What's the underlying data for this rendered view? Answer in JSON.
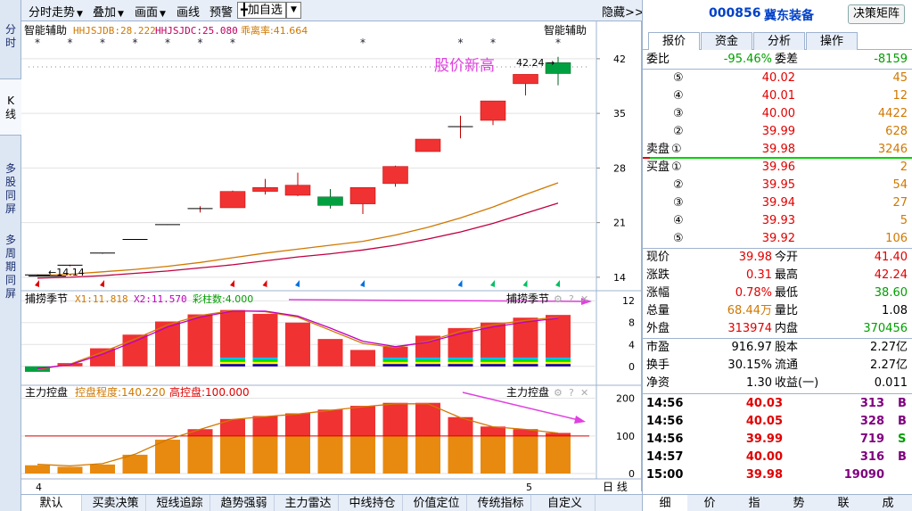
{
  "left_tabs": [
    {
      "label": "分\n时",
      "active": false
    },
    {
      "label": "K\n线",
      "active": true
    },
    {
      "label": "多\n股\n同\n屏",
      "active": false
    },
    {
      "label": "多\n周\n期\n同\n屏",
      "active": false
    }
  ],
  "toolbar": {
    "items": [
      "分时走势",
      "叠加",
      "画面",
      "画线",
      "预警"
    ],
    "add_select": "╋加自选",
    "hide": "隐藏>>"
  },
  "main_panel": {
    "indicator_name": "智能辅助",
    "indicator_name_right": "智能辅助",
    "legend": [
      {
        "text": "HHJSJDB:28.222",
        "color": "#d07800"
      },
      {
        "text": "HHJSJDC:25.080",
        "color": "#c00060"
      },
      {
        "text": "乖离率:41.664",
        "color": "#d07800"
      }
    ],
    "annotation": "股价新高",
    "annotation_color": "#e040e0",
    "high_label": "42.24",
    "low_label": "14.14",
    "y_ticks": [
      "42",
      "35",
      "28",
      "21",
      "14"
    ]
  },
  "sub_panel_1": {
    "name": "捕捞季节",
    "name_right": "捕捞季节",
    "legend": [
      {
        "text": "X1:11.818",
        "color": "#d07800"
      },
      {
        "text": "X2:11.570",
        "color": "#c000c0"
      },
      {
        "text": "彩柱数:4.000",
        "color": "#00a000"
      }
    ],
    "y_ticks": [
      "12",
      "8",
      "4",
      "0"
    ]
  },
  "sub_panel_2": {
    "name": "主力控盘",
    "name_right": "主力控盘",
    "legend": [
      {
        "text": "控盘程度:140.220",
        "color": "#d07800"
      },
      {
        "text": "高控盘:100.000",
        "color": "#e00000"
      }
    ],
    "y_ticks": [
      "200",
      "100",
      "0"
    ]
  },
  "x_axis": {
    "labels": [
      "4",
      "5"
    ],
    "period": "日 线"
  },
  "bottom_tabs": [
    "默认",
    "买卖决策",
    "短线追踪",
    "趋势强弱",
    "主力雷达",
    "中线持仓",
    "价值定位",
    "传统指标",
    "自定义"
  ],
  "chart_data": [
    {
      "type": "candlestick",
      "title": "智能辅助",
      "candles": [
        {
          "open": 14.14,
          "close": 14.3,
          "high": 14.35,
          "low": 14.14
        },
        {
          "open": 15.4,
          "close": 15.55,
          "high": 15.6,
          "low": 15.4
        },
        {
          "open": 17.0,
          "close": 17.1,
          "high": 17.1,
          "low": 17.0
        },
        {
          "open": 18.8,
          "close": 18.85,
          "high": 18.85,
          "low": 18.8
        },
        {
          "open": 20.7,
          "close": 20.75,
          "high": 20.75,
          "low": 20.7
        },
        {
          "open": 22.8,
          "close": 22.8,
          "high": 23.1,
          "low": 22.3
        },
        {
          "open": 22.9,
          "close": 25.0,
          "high": 25.1,
          "low": 22.9
        },
        {
          "open": 25.0,
          "close": 25.5,
          "high": 26.6,
          "low": 24.6
        },
        {
          "open": 24.5,
          "close": 25.8,
          "high": 27.4,
          "low": 24.4
        },
        {
          "open": 24.3,
          "close": 23.2,
          "high": 25.3,
          "low": 22.8
        },
        {
          "open": 23.4,
          "close": 25.5,
          "high": 25.5,
          "low": 22.1
        },
        {
          "open": 26.0,
          "close": 28.2,
          "high": 28.3,
          "low": 25.6
        },
        {
          "open": 30.1,
          "close": 31.7,
          "high": 31.7,
          "low": 30.1
        },
        {
          "open": 33.2,
          "close": 33.3,
          "high": 34.7,
          "low": 31.8
        },
        {
          "open": 34.1,
          "close": 36.6,
          "high": 36.6,
          "low": 33.5
        },
        {
          "open": 38.8,
          "close": 40.0,
          "high": 40.0,
          "low": 37.3
        },
        {
          "open": 41.5,
          "close": 40.1,
          "high": 42.24,
          "low": 38.6
        }
      ],
      "ma1": [
        14.2,
        14.4,
        14.7,
        15.0,
        15.4,
        15.9,
        16.5,
        17.1,
        17.6,
        18.1,
        18.6,
        19.4,
        20.4,
        21.6,
        23.0,
        24.6,
        26.1
      ],
      "ma2": [
        13.9,
        14.0,
        14.2,
        14.5,
        14.8,
        15.2,
        15.6,
        16.1,
        16.6,
        17.0,
        17.5,
        18.1,
        18.9,
        19.8,
        20.9,
        22.2,
        23.5
      ],
      "signal_arrows": [
        "red",
        "",
        "red",
        "",
        "",
        "",
        "red",
        "red",
        "blue",
        "",
        "blue",
        "",
        "",
        "blue",
        "green",
        "green",
        "green"
      ],
      "stars": [
        1,
        1,
        1,
        1,
        1,
        1,
        1,
        0,
        0,
        0,
        1,
        0,
        0,
        1,
        1,
        0,
        1
      ],
      "ylim": [
        12.5,
        44.5
      ]
    },
    {
      "type": "bar",
      "title": "捕捞季节",
      "values": [
        -1.0,
        0.6,
        3.3,
        5.8,
        8.2,
        9.5,
        10.3,
        9.6,
        8.0,
        5.0,
        3.0,
        3.6,
        5.6,
        7.0,
        8.0,
        8.9,
        9.4,
        8.9
      ],
      "x1": [
        -0.6,
        0.4,
        2.6,
        5.0,
        7.6,
        9.3,
        10.2,
        10.0,
        9.0,
        6.6,
        4.2,
        3.4,
        4.6,
        6.4,
        7.6,
        8.4,
        9.0,
        8.8
      ],
      "x2": [
        -0.4,
        0.3,
        2.2,
        4.6,
        7.2,
        9.0,
        10.1,
        10.1,
        9.2,
        7.0,
        4.6,
        3.6,
        4.4,
        6.0,
        7.2,
        8.1,
        8.8,
        8.6
      ],
      "colored_bars": [
        0,
        0,
        0,
        0,
        0,
        0,
        1,
        1,
        0,
        0,
        0,
        1,
        1,
        1,
        1,
        1,
        1,
        1
      ],
      "ylim": [
        -1.5,
        13.5
      ]
    },
    {
      "type": "bar",
      "title": "主力控盘",
      "values": [
        22,
        18,
        24,
        50,
        90,
        118,
        145,
        153,
        160,
        170,
        180,
        188,
        188,
        150,
        125,
        118,
        108
      ],
      "level": 100,
      "ylim": [
        0,
        230
      ]
    }
  ],
  "quote_panel": {
    "code": "000856",
    "name": "冀东装备",
    "button": "决策矩阵",
    "tabs": [
      "报价",
      "资金",
      "分析",
      "操作"
    ],
    "weibi_label": "委比",
    "weibi": "-95.46%",
    "weicha_label": "委差",
    "weicha": "-8159",
    "sell_label": "卖盘",
    "buy_label": "买盘",
    "sells": [
      {
        "lvl": "⑤",
        "price": "40.02",
        "vol": "45"
      },
      {
        "lvl": "④",
        "price": "40.01",
        "vol": "12"
      },
      {
        "lvl": "③",
        "price": "40.00",
        "vol": "4422"
      },
      {
        "lvl": "②",
        "price": "39.99",
        "vol": "628"
      },
      {
        "lvl": "①",
        "price": "39.98",
        "vol": "3246"
      }
    ],
    "buys": [
      {
        "lvl": "①",
        "price": "39.96",
        "vol": "2"
      },
      {
        "lvl": "②",
        "price": "39.95",
        "vol": "54"
      },
      {
        "lvl": "③",
        "price": "39.94",
        "vol": "27"
      },
      {
        "lvl": "④",
        "price": "39.93",
        "vol": "5"
      },
      {
        "lvl": "⑤",
        "price": "39.92",
        "vol": "106"
      }
    ],
    "stats": [
      {
        "l1": "现价",
        "v1": "39.98",
        "c1": "red",
        "l2": "今开",
        "v2": "41.40",
        "c2": "red"
      },
      {
        "l1": "涨跌",
        "v1": "0.31",
        "c1": "red",
        "l2": "最高",
        "v2": "42.24",
        "c2": "red"
      },
      {
        "l1": "涨幅",
        "v1": "0.78%",
        "c1": "red",
        "l2": "最低",
        "v2": "38.60",
        "c2": "green"
      },
      {
        "l1": "总量",
        "v1": "68.44万",
        "c1": "orange",
        "l2": "量比",
        "v2": "1.08",
        "c2": ""
      },
      {
        "l1": "外盘",
        "v1": "313974",
        "c1": "red",
        "l2": "内盘",
        "v2": "370456",
        "c2": "green"
      }
    ],
    "stats2": [
      {
        "l1": "市盈",
        "v1": "916.97",
        "l2": "股本",
        "v2": "2.27亿"
      },
      {
        "l1": "换手",
        "v1": "30.15%",
        "l2": "流通",
        "v2": "2.27亿"
      },
      {
        "l1": "净资",
        "v1": "1.30",
        "l2": "收益(一)",
        "v2": "0.011"
      }
    ],
    "ticks": [
      {
        "time": "14:56",
        "price": "40.03",
        "vol": "313",
        "side": "B"
      },
      {
        "time": "14:56",
        "price": "40.05",
        "vol": "328",
        "side": "B"
      },
      {
        "time": "14:56",
        "price": "39.99",
        "vol": "719",
        "side": "S"
      },
      {
        "time": "14:57",
        "price": "40.00",
        "vol": "316",
        "side": "B"
      },
      {
        "time": "15:00",
        "price": "39.98",
        "vol": "19090",
        "side": ""
      }
    ],
    "bottom_tabs": [
      "细",
      "价",
      "指",
      "势",
      "联",
      "成"
    ]
  },
  "colors": {
    "up": "#f03232",
    "down": "#00a040",
    "bg": "#ffffff",
    "grid": "#e2e2e2"
  }
}
